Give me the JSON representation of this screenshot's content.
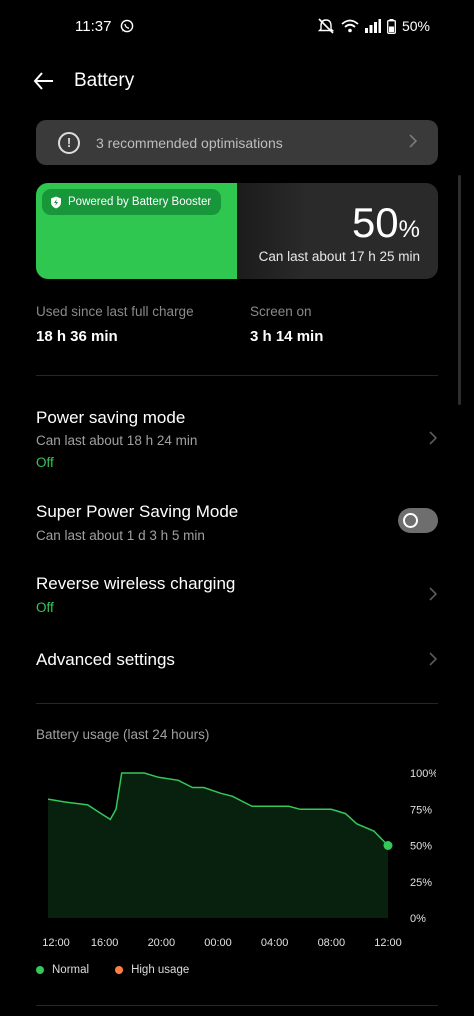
{
  "status_bar": {
    "time": "11:37",
    "battery_percent": "50%",
    "icons": [
      "whatsapp-icon",
      "mute-icon",
      "wifi-icon",
      "signal-icon",
      "battery-icon"
    ]
  },
  "header": {
    "title": "Battery"
  },
  "recommendation": {
    "text": "3 recommended optimisations"
  },
  "battery_card": {
    "booster_label": "Powered by Battery Booster",
    "percent": "50",
    "percent_sign": "%",
    "level": 0.5,
    "estimate": "Can last about 17 h 25 min",
    "fill_color": "#2fc74f"
  },
  "usage": {
    "since_label": "Used since last full charge",
    "since_value": "18 h 36 min",
    "screen_label": "Screen on",
    "screen_value": "3 h 14 min"
  },
  "settings": {
    "power_saving": {
      "title": "Power saving mode",
      "subtitle": "Can last about 18 h 24 min",
      "state": "Off"
    },
    "super_saving": {
      "title": "Super Power Saving Mode",
      "subtitle": "Can last about 1 d 3 h 5 min",
      "enabled": false
    },
    "reverse_wireless": {
      "title": "Reverse wireless charging",
      "state": "Off"
    },
    "advanced": {
      "title": "Advanced settings"
    }
  },
  "chart_data": {
    "type": "area",
    "title": "Battery usage (last 24 hours)",
    "x_ticks": [
      "12:00",
      "16:00",
      "20:00",
      "00:00",
      "04:00",
      "08:00",
      "12:00"
    ],
    "y_ticks": [
      "100%",
      "75%",
      "50%",
      "25%",
      "0%"
    ],
    "ylim": [
      0,
      100
    ],
    "x_range_hours": [
      0,
      24
    ],
    "series": [
      {
        "points": [
          [
            0,
            82
          ],
          [
            1.2,
            80
          ],
          [
            2.8,
            78
          ],
          [
            3.6,
            73
          ],
          [
            4.4,
            68
          ],
          [
            4.8,
            75
          ],
          [
            5.2,
            100
          ],
          [
            6.8,
            100
          ],
          [
            7.8,
            97
          ],
          [
            9.2,
            95
          ],
          [
            10.2,
            90
          ],
          [
            11.0,
            90
          ],
          [
            12.2,
            86
          ],
          [
            13.0,
            84
          ],
          [
            14.4,
            77
          ],
          [
            17.0,
            77
          ],
          [
            17.8,
            75
          ],
          [
            20.0,
            75
          ],
          [
            21.0,
            72
          ],
          [
            21.8,
            65
          ],
          [
            23.0,
            60
          ],
          [
            24.0,
            50
          ]
        ]
      }
    ],
    "legend": [
      "Normal",
      "High usage"
    ],
    "colors": {
      "normal": "#34c759",
      "high": "#ff7f3f"
    },
    "grid": false
  }
}
